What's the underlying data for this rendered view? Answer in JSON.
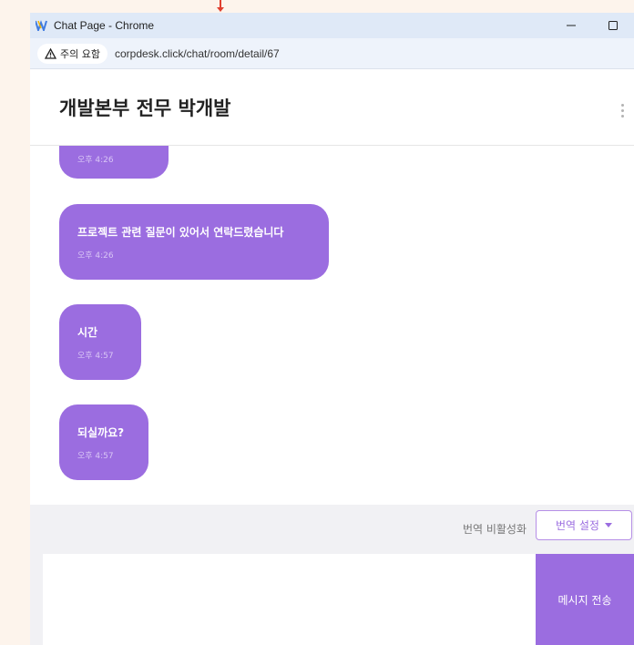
{
  "window": {
    "title": "Chat Page - Chrome"
  },
  "address_bar": {
    "security_label": "주의 요함",
    "url": "corpdesk.click/chat/room/detail/67"
  },
  "chat": {
    "title": "개발본부 전무 박개발"
  },
  "messages": [
    {
      "text": "",
      "time": "오후 4:26"
    },
    {
      "text": "프로젝트 관련 질문이 있어서 연락드렸습니다",
      "time": "오후 4:26"
    },
    {
      "text": "시간",
      "time": "오후 4:57"
    },
    {
      "text": "되실까요?",
      "time": "오후 4:57"
    }
  ],
  "translation": {
    "status": "번역 비활성화",
    "settings_label": "번역 설정"
  },
  "composer": {
    "placeholder": "",
    "send_label": "메시지 전송"
  },
  "colors": {
    "accent": "#9b6de0",
    "titlebar": "#dfe9f7"
  }
}
